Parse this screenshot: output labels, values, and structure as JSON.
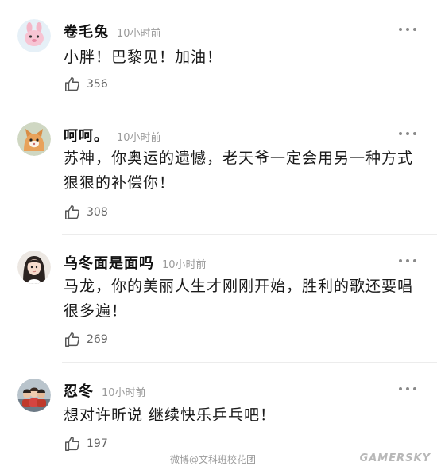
{
  "comments": [
    {
      "username": "卷毛兔",
      "time": "10小时前",
      "text": "小胖！巴黎见！加油！",
      "likes": "356",
      "avatar": "pink-bunny-avatar"
    },
    {
      "username": "呵呵。",
      "time": "10小时前",
      "text": "苏神，你奥运的遗憾，老天爷一定会用另一种方式狠狠的补偿你！",
      "likes": "308",
      "avatar": "cat-avatar"
    },
    {
      "username": "乌冬面是面吗",
      "time": "10小时前",
      "text": "马龙，你的美丽人生才刚刚开始，胜利的歌还要唱很多遍！",
      "likes": "269",
      "avatar": "girl-avatar"
    },
    {
      "username": "忍冬",
      "time": "10小时前",
      "text": "想对许昕说 继续快乐乒乓吧！",
      "likes": "197",
      "avatar": "group-photo-avatar"
    }
  ],
  "watermark": "微博@文科班校花团",
  "brand": "GAMERSKY",
  "icons": {
    "like": "thumbs-up-icon",
    "more": "more-dots-icon"
  },
  "colors": {
    "username": "#111111",
    "timestamp": "#9a9a9a",
    "text": "#1a1a1a",
    "divider": "#ececec"
  }
}
